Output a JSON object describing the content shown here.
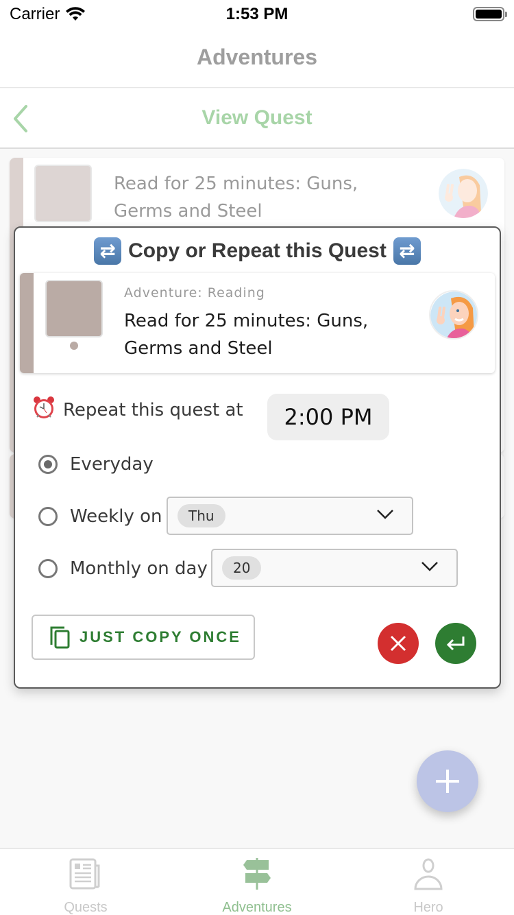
{
  "status_bar": {
    "carrier": "Carrier",
    "time": "1:53 PM"
  },
  "header": {
    "title": "Adventures"
  },
  "sub_header": {
    "title": "View Quest",
    "back_icon": "chevron-left-icon",
    "color": "#a8d5a8"
  },
  "background_cards": [
    {
      "text": "Read for 25 minutes: Guns, Germs and Steel"
    }
  ],
  "modal": {
    "title": "Copy or Repeat this Quest",
    "title_icon": "repeat-icon",
    "quest": {
      "adventure": "Adventure: Reading",
      "text": "Read for 25 minutes: Guns, Germs and Steel",
      "color": "#baaba5"
    },
    "repeat_label": "Repeat this quest at",
    "repeat_icon": "alarm-clock-icon",
    "time": "2:00 PM",
    "options": [
      {
        "label": "Everyday",
        "checked": true
      },
      {
        "label": "Weekly on",
        "checked": false,
        "value": "Thu"
      },
      {
        "label": "Monthly on day",
        "checked": false,
        "value": "20"
      }
    ],
    "copy_button": "JUST COPY ONCE",
    "cancel_icon": "close-icon",
    "confirm_icon": "enter-icon",
    "colors": {
      "accent": "#2e7d32",
      "danger": "#d32f2f"
    }
  },
  "fab": {
    "icon": "plus-icon",
    "color": "#bcc4e6"
  },
  "tabs": [
    {
      "label": "Quests",
      "icon": "newspaper-icon",
      "active": false
    },
    {
      "label": "Adventures",
      "icon": "signpost-icon",
      "active": true
    },
    {
      "label": "Hero",
      "icon": "person-icon",
      "active": false
    }
  ]
}
